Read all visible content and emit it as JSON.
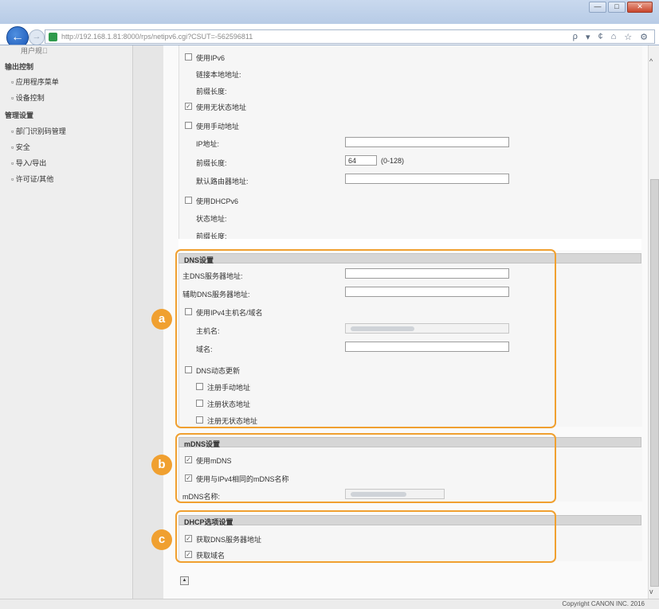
{
  "browser": {
    "url": "http://192.168.1.81:8000/rps/netipv6.cgi?CSUT=-562596811",
    "tools": [
      "ρ",
      "▾",
      "¢"
    ],
    "window_controls": [
      "—",
      "□",
      "✕"
    ]
  },
  "sidebar": {
    "items": [
      {
        "label": "用户规\u0000",
        "kind": "sub"
      },
      {
        "label": "输出控制",
        "kind": "header"
      },
      {
        "label": "应用程序菜单",
        "kind": "sub"
      },
      {
        "label": "设备控制",
        "kind": "sub"
      },
      {
        "label": "管理设置",
        "kind": "header"
      },
      {
        "label": "部门识别码管理",
        "kind": "sub"
      },
      {
        "label": "安全",
        "kind": "sub"
      },
      {
        "label": "导入/导出",
        "kind": "sub"
      },
      {
        "label": "许可证/其他",
        "kind": "sub"
      }
    ]
  },
  "ipv6": {
    "use_ipv6": "使用IPv6",
    "link_local": "链接本地地址:",
    "prefix_len_1": "前缀长度:",
    "use_stateless": "使用无状态地址",
    "use_manual": "使用手动地址",
    "ip_address": "IP地址:",
    "prefix_len_2": "前缀长度:",
    "prefix_value": "64",
    "prefix_range": "(0-128)",
    "default_router": "默认路由器地址:",
    "use_dhcpv6": "使用DHCPv6",
    "state_address": "状态地址:",
    "prefix_len_3": "前缀长度:"
  },
  "dns": {
    "title": "DNS设置",
    "primary": "主DNS服务器地址:",
    "secondary": "辅助DNS服务器地址:",
    "use_ipv4_host": "使用IPv4主机名/域名",
    "host_name": "主机名:",
    "domain_name": "域名:",
    "dynamic_update": "DNS动态更新",
    "reg_manual": "注册手动地址",
    "reg_state": "注册状态地址",
    "reg_stateless": "注册无状态地址"
  },
  "mdns": {
    "title": "mDNS设置",
    "use_mdns": "使用mDNS",
    "same_name": "使用与IPv4相同的mDNS名称",
    "mdns_name": "mDNS名称:"
  },
  "dhcp": {
    "title": "DHCP选项设置",
    "get_dns": "获取DNS服务器地址",
    "get_domain": "获取域名"
  },
  "badges": {
    "a": "a",
    "b": "b",
    "c": "c"
  },
  "footer": {
    "copyright": "Copyright CANON INC. 2016"
  },
  "colors": {
    "highlight": "#f0a030",
    "section_header": "#d6d6d6",
    "sidebar": "#eeeeee"
  }
}
